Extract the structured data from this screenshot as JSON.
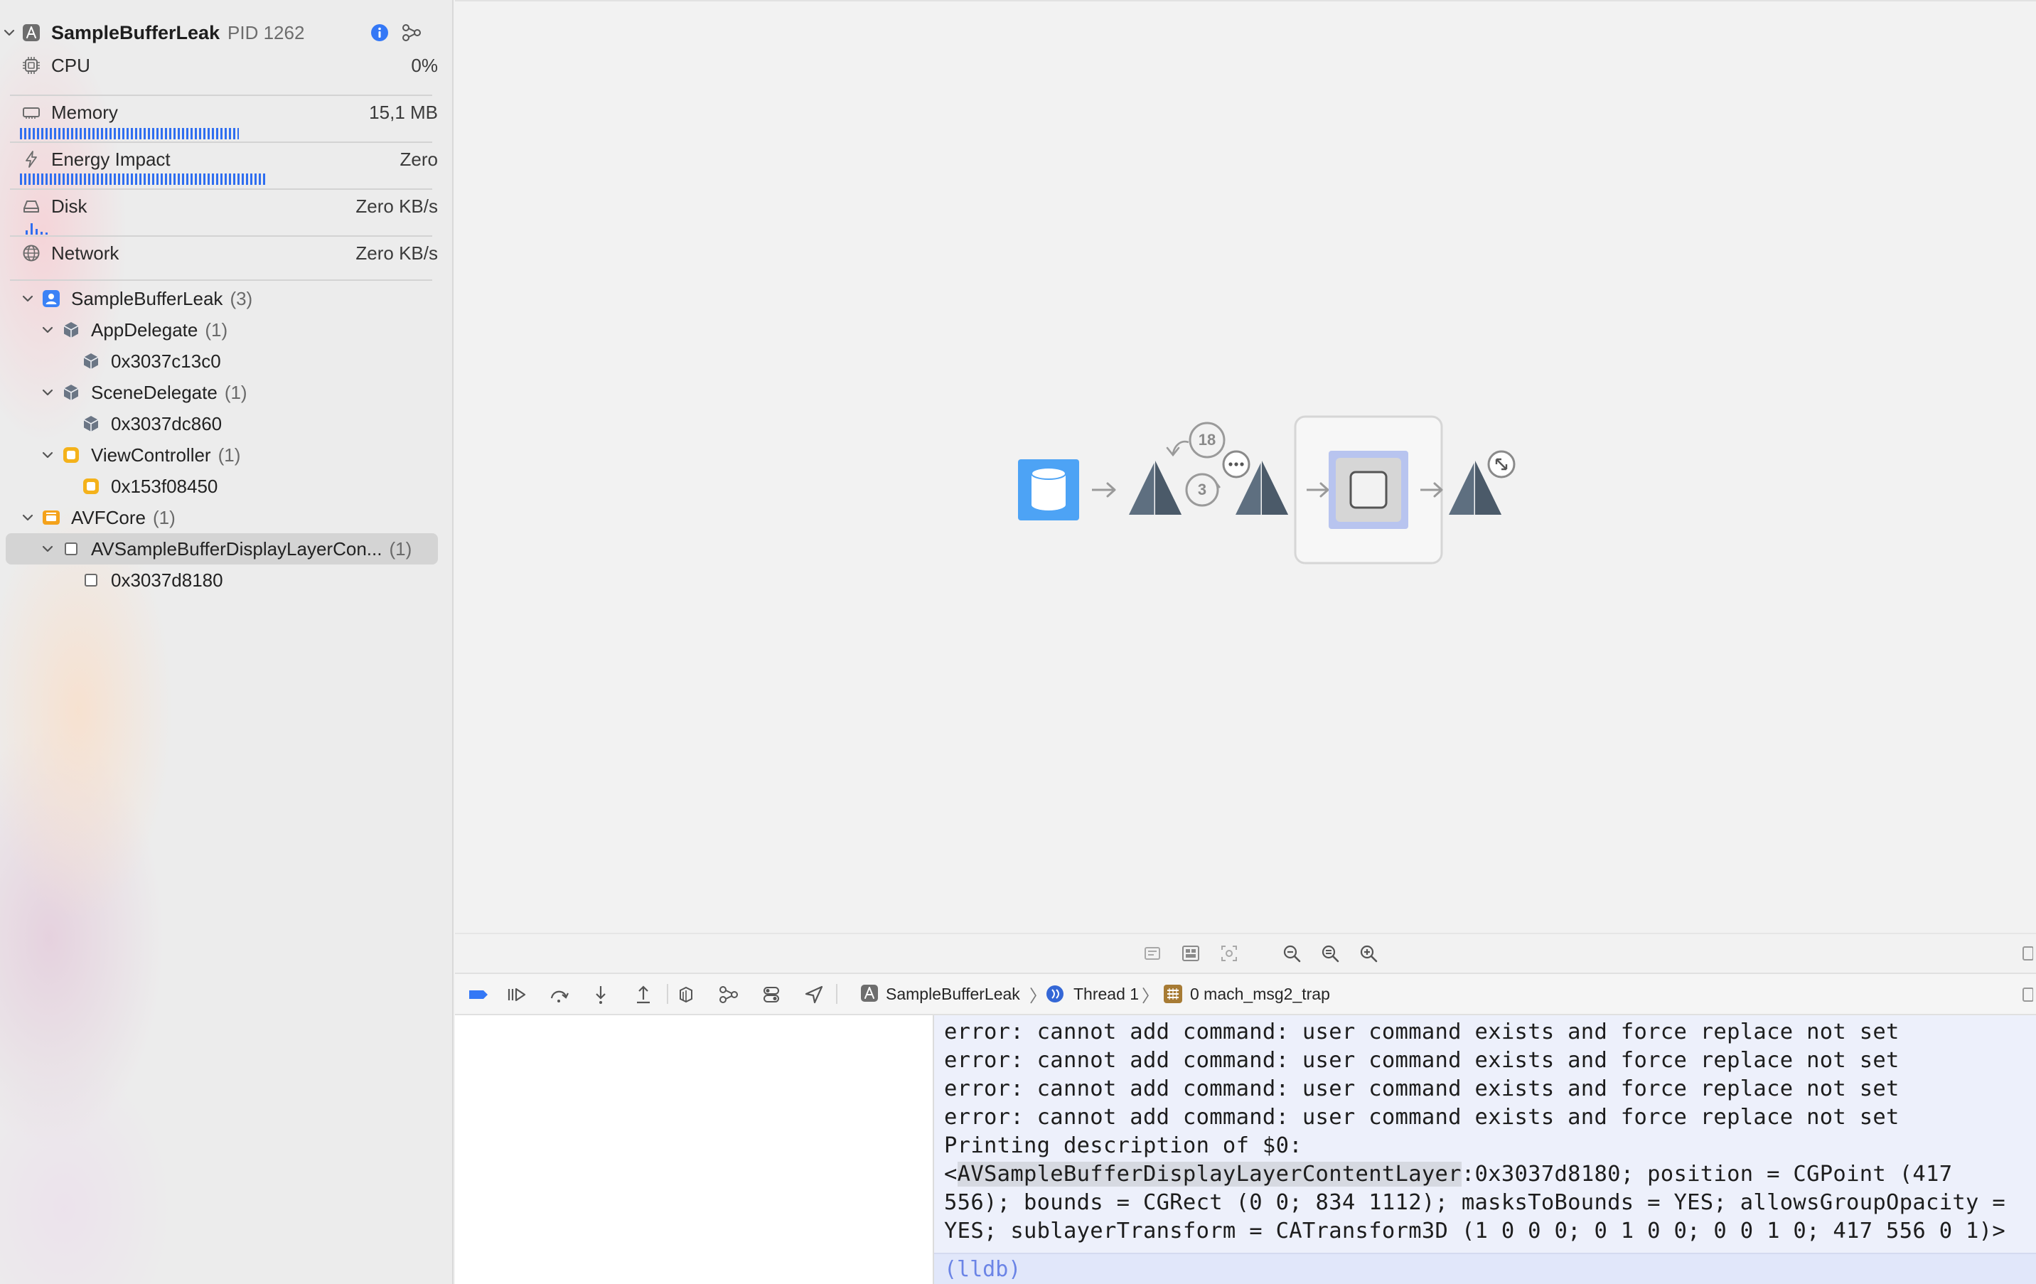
{
  "process": {
    "name": "SampleBufferLeak",
    "pid_label": "PID 1262"
  },
  "gauges": {
    "cpu": {
      "label": "CPU",
      "value": "0%"
    },
    "memory": {
      "label": "Memory",
      "value": "15,1 MB",
      "meter_fraction": 0.55
    },
    "energy": {
      "label": "Energy Impact",
      "value": "Zero",
      "meter_fraction": 0.62
    },
    "disk": {
      "label": "Disk",
      "value": "Zero KB/s"
    },
    "network": {
      "label": "Network",
      "value": "Zero KB/s"
    }
  },
  "tree": [
    {
      "label": "SampleBufferLeak",
      "count": "(3)"
    },
    {
      "label": "AppDelegate",
      "count": "(1)"
    },
    {
      "label": "0x3037c13c0",
      "count": ""
    },
    {
      "label": "SceneDelegate",
      "count": "(1)"
    },
    {
      "label": "0x3037dc860",
      "count": ""
    },
    {
      "label": "ViewController",
      "count": "(1)"
    },
    {
      "label": "0x153f08450",
      "count": ""
    },
    {
      "label": "AVFCore",
      "count": "(1)"
    },
    {
      "label": "AVSampleBufferDisplayLayerCon...",
      "count": "(1)"
    },
    {
      "label": "0x3037d8180",
      "count": ""
    }
  ],
  "graph": {
    "badge_top": "18",
    "badge_bottom": "3"
  },
  "debug_bar": {
    "crumbs": [
      "SampleBufferLeak",
      "Thread 1",
      "0 mach_msg2_trap"
    ]
  },
  "console": {
    "lines": [
      "error: cannot add command: user command exists and force replace not set",
      "error: cannot add command: user command exists and force replace not set",
      "error: cannot add command: user command exists and force replace not set",
      "error: cannot add command: user command exists and force replace not set",
      "Printing description of $0:"
    ],
    "desc_open": "<",
    "desc_class": "AVSampleBufferDisplayLayerContentLayer",
    "desc_rest": ":0x3037d8180; position = CGPoint (417",
    "desc_line2": "556); bounds = CGRect (0 0; 834 1112); masksToBounds = YES; allowsGroupOpacity =",
    "desc_line3": "YES; sublayerTransform = CATransform3D (1 0 0 0; 0 1 0 0; 0 0 1 0; 417 556 0 1)>",
    "prompt": "(lldb)"
  },
  "colors": {
    "accent": "#2f6ef0",
    "node_blue": "#4da3f5",
    "pyramid": "#5e6f80",
    "selected": "#d4d4d4"
  }
}
